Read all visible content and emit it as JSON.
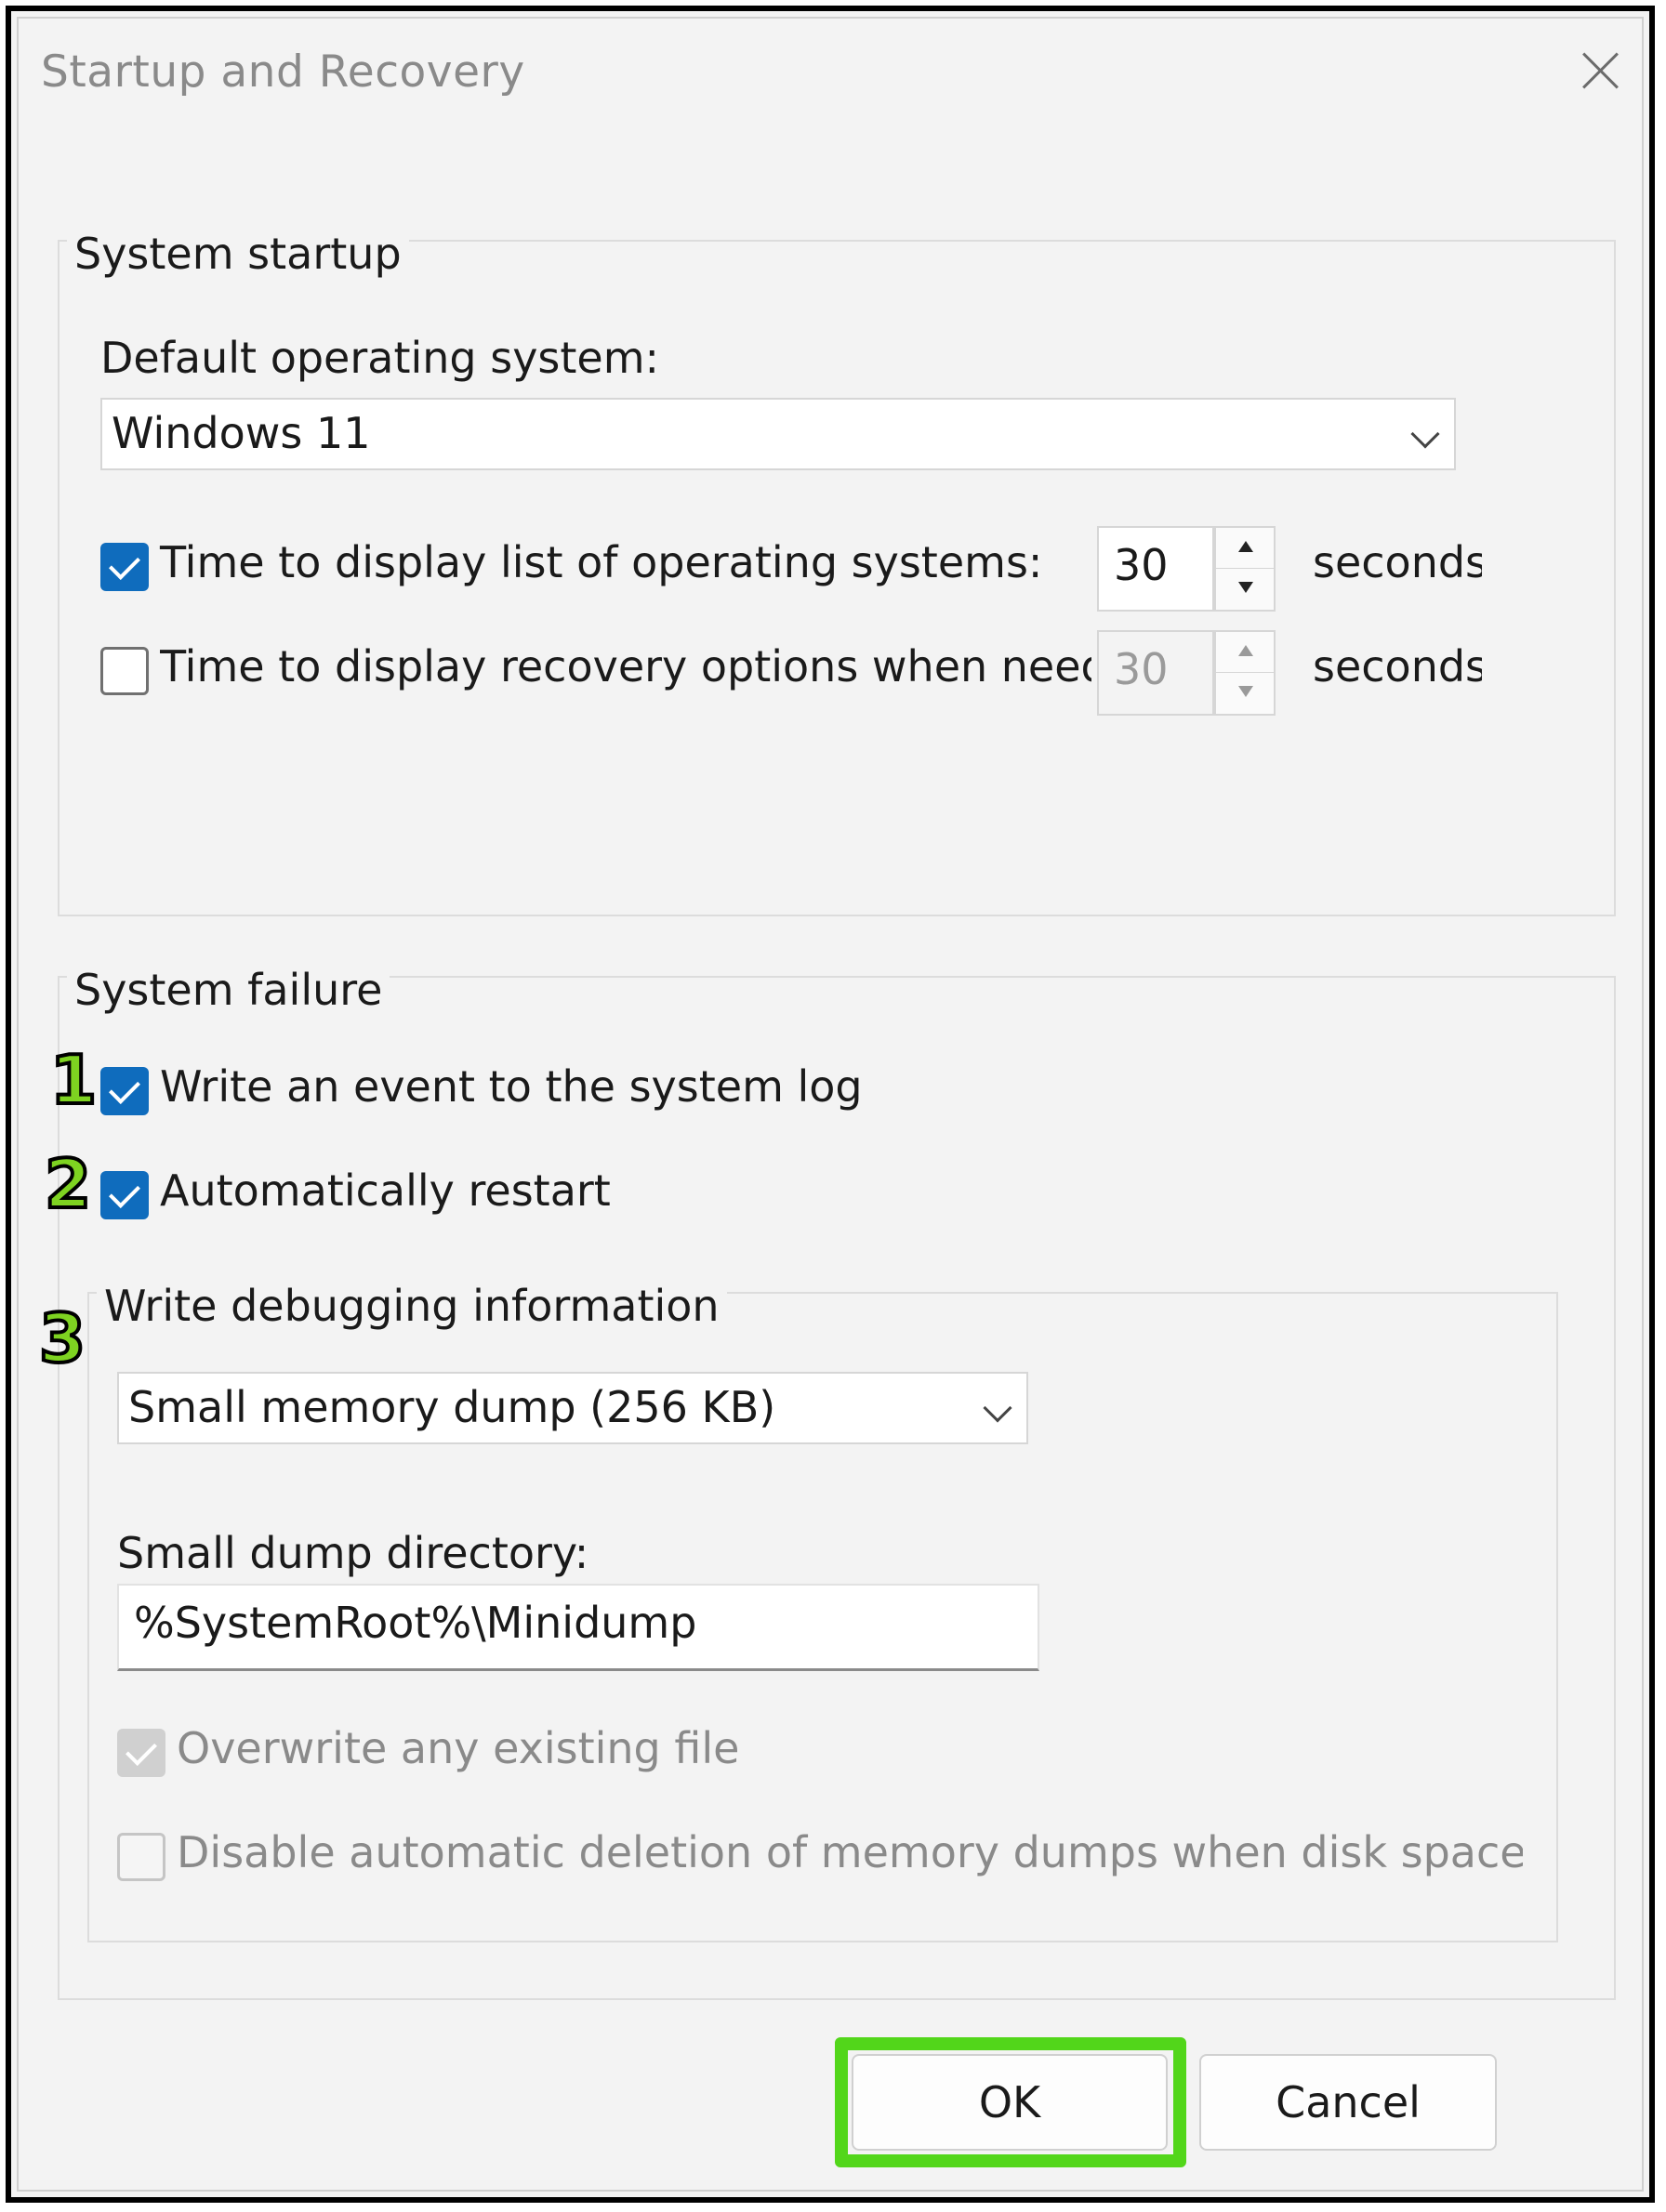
{
  "window": {
    "title": "Startup and Recovery"
  },
  "system_startup": {
    "label": "System startup",
    "default_os_label": "Default operating system:",
    "default_os_value": "Windows 11",
    "display_list": {
      "label": "Time to display list of operating systems:",
      "checked": true,
      "value": "30",
      "unit": "seconds"
    },
    "display_recovery": {
      "label": "Time to display recovery options when needed",
      "checked": false,
      "value": "30",
      "unit": "seconds"
    }
  },
  "system_failure": {
    "label": "System failure",
    "write_event": {
      "label": "Write an event to the system log",
      "checked": true
    },
    "auto_restart": {
      "label": "Automatically restart",
      "checked": true
    },
    "debug": {
      "label": "Write debugging information",
      "dump_type": "Small memory dump (256 KB)",
      "dir_label": "Small dump directory:",
      "dir_value": "%SystemRoot%\\Minidump",
      "overwrite": {
        "label": "Overwrite any existing file",
        "checked": true,
        "disabled": true
      },
      "disable_deletion": {
        "label": "Disable automatic deletion of memory dumps when disk space is lc",
        "checked": false,
        "disabled": true
      }
    }
  },
  "annotations": {
    "step1": "1",
    "step2": "2",
    "step3": "3",
    "highlight_color": "#52d61a"
  },
  "buttons": {
    "ok": "OK",
    "cancel": "Cancel"
  }
}
